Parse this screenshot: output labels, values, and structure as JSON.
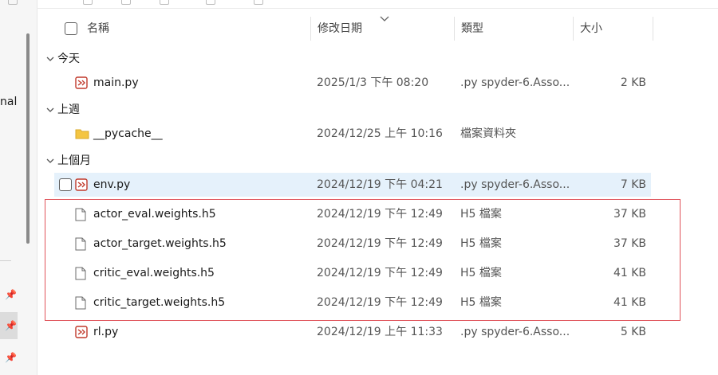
{
  "header": {
    "name_label": "名稱",
    "date_label": "修改日期",
    "type_label": "類型",
    "size_label": "大小"
  },
  "sidebar": {
    "label": "nal"
  },
  "groups": [
    {
      "label": "今天"
    },
    {
      "label": "上週"
    },
    {
      "label": "上個月"
    }
  ],
  "files": [
    {
      "name": "main.py",
      "date": "2025/1/3 下午 08:20",
      "type": ".py spyder-6.Asso...",
      "size": "2 KB",
      "icon": "python-file-icon"
    },
    {
      "name": "__pycache__",
      "date": "2024/12/25 上午 10:16",
      "type": "檔案資料夾",
      "size": "",
      "icon": "folder-icon"
    },
    {
      "name": "env.py",
      "date": "2024/12/19 下午 04:21",
      "type": ".py spyder-6.Asso...",
      "size": "7 KB",
      "icon": "python-file-icon"
    },
    {
      "name": "actor_eval.weights.h5",
      "date": "2024/12/19 下午 12:49",
      "type": "H5 檔案",
      "size": "37 KB",
      "icon": "generic-file-icon"
    },
    {
      "name": "actor_target.weights.h5",
      "date": "2024/12/19 下午 12:49",
      "type": "H5 檔案",
      "size": "37 KB",
      "icon": "generic-file-icon"
    },
    {
      "name": "critic_eval.weights.h5",
      "date": "2024/12/19 下午 12:49",
      "type": "H5 檔案",
      "size": "41 KB",
      "icon": "generic-file-icon"
    },
    {
      "name": "critic_target.weights.h5",
      "date": "2024/12/19 下午 12:49",
      "type": "H5 檔案",
      "size": "41 KB",
      "icon": "generic-file-icon"
    },
    {
      "name": "rl.py",
      "date": "2024/12/19 上午 11:33",
      "type": ".py spyder-6.Asso...",
      "size": "5 KB",
      "icon": "python-file-icon"
    }
  ],
  "colors": {
    "hover": "#e5f1fb",
    "highlight_border": "#e0535a",
    "folder": "#f4c542"
  }
}
